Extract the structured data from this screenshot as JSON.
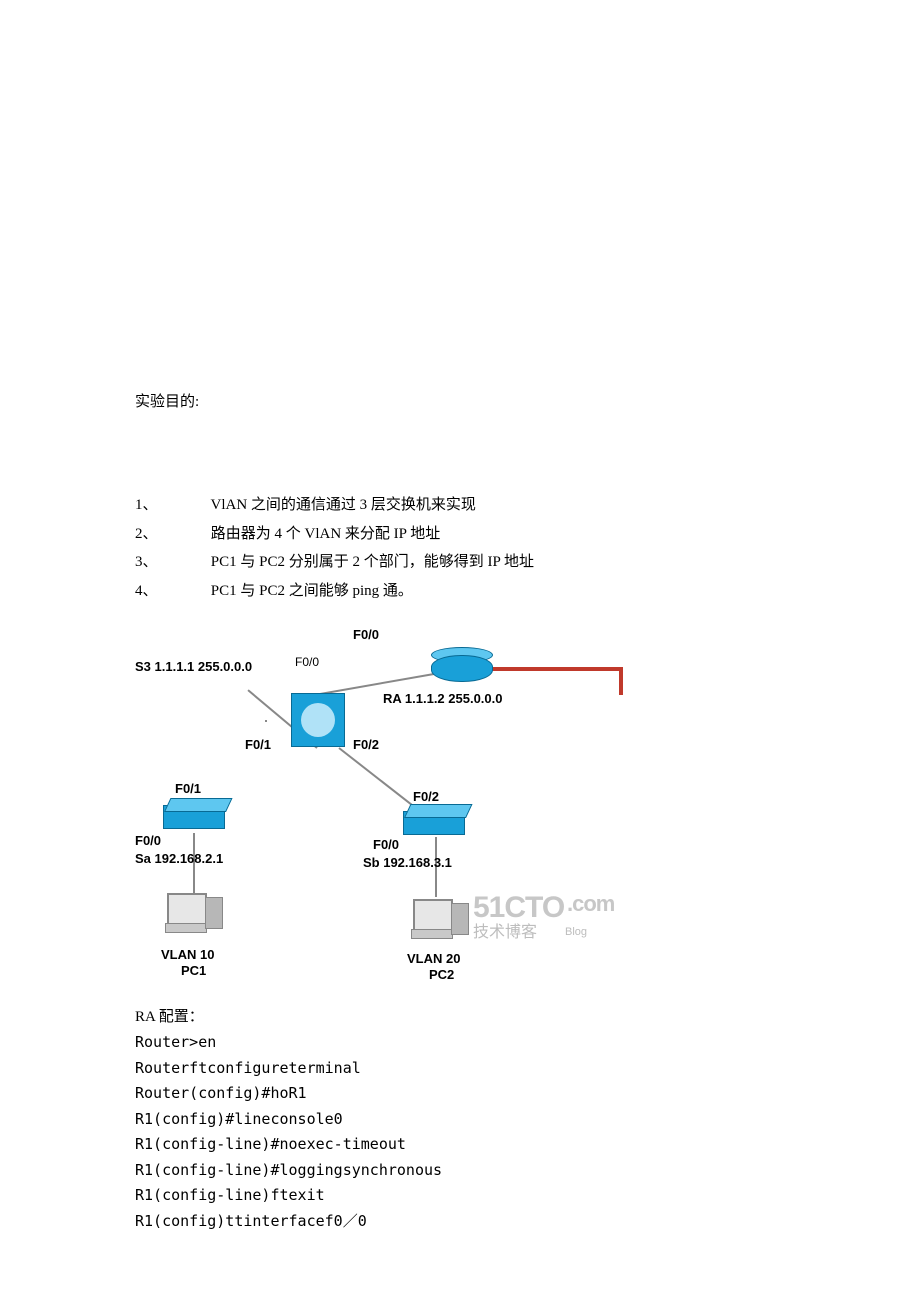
{
  "heading": "实验目的:",
  "objectives": [
    {
      "num": "1、",
      "text": "VlAN 之间的通信通过 3 层交换机来实现"
    },
    {
      "num": "2、",
      "text": "路由器为 4 个 VlAN 来分配 IP 地址"
    },
    {
      "num": "3、",
      "text": "PC1 与 PC2 分别属于 2 个部门，能够得到 IP 地址"
    },
    {
      "num": "4、",
      "text": "PC1 与 PC2 之间能够 ping 通。"
    }
  ],
  "diagram": {
    "s3_label": "S3 1.1.1.1 255.0.0.0",
    "ra_label": "RA 1.1.1.2    255.0.0.0",
    "f00_top_left": "F0/0",
    "f00_top_router": "F0/0",
    "f01_mid": "F0/1",
    "f02_mid": "F0/2",
    "f01_sa_top": "F0/1",
    "f02_sb_top": "F0/2",
    "f00_sa": "F0/0",
    "f00_sb": "F0/0",
    "sa_label": "Sa  192.168.2.1",
    "sb_label": "Sb 192.168.3.1",
    "vlan10": "VLAN 10",
    "pc1": "PC1",
    "vlan20": "VLAN 20",
    "pc2": "PC2",
    "watermark_big": "51CTO",
    "watermark_dot": ".com",
    "watermark_cn": "技术博客",
    "watermark_small": "Blog"
  },
  "config_title": "RA 配置：",
  "config_lines": [
    "Router>en",
    "Routerftconfigureterminal",
    "Router(config)#hoR1",
    "R1(config)#lineconsole0",
    "R1(config-line)#noexec-timeout",
    "R1(config-line)#loggingsynchronous",
    "R1(config-line)ftexit",
    "R1(config)ttinterfacef0／0"
  ]
}
